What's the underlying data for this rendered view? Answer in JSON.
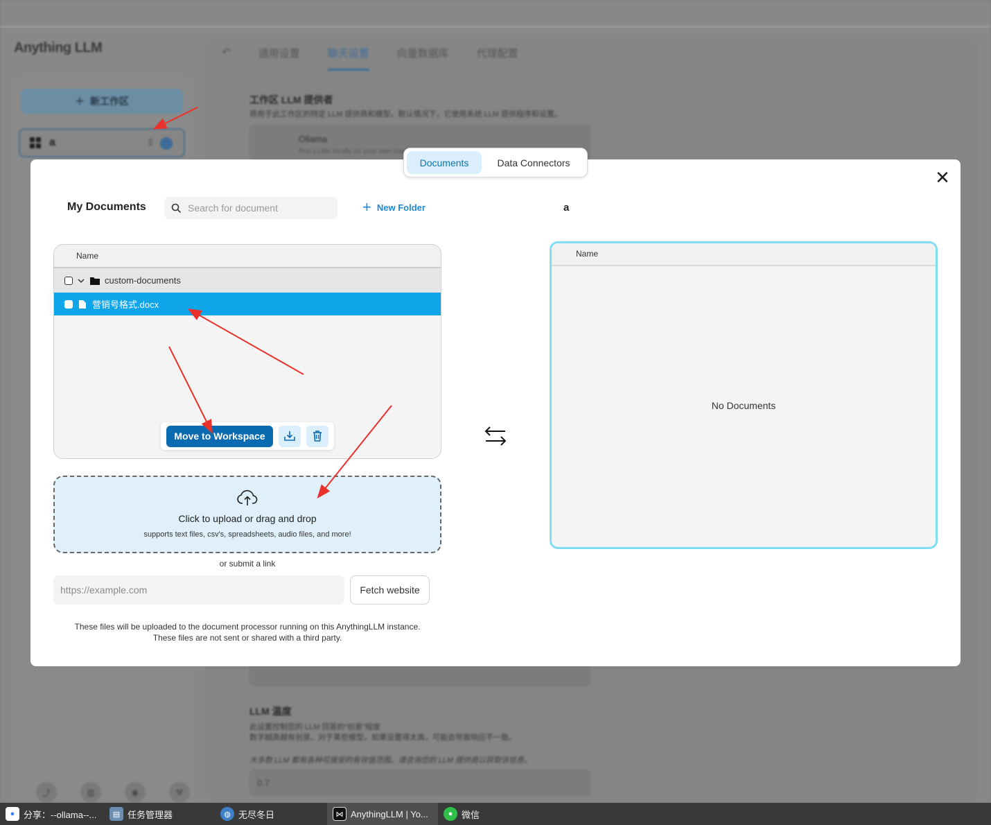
{
  "background_app": {
    "logo": "Anything LLM",
    "new_workspace_label": "新工作区",
    "workspace_name": "a",
    "tabs": [
      "通用设置",
      "聊天设置",
      "向量数据库",
      "代理配置"
    ],
    "active_tab": "聊天设置",
    "llm_provider_heading": "工作区 LLM 提供者",
    "llm_provider_desc": "将用于此工作区的特定 LLM 提供商和模型。默认情况下，它使用系统 LLM 提供程序和设置。",
    "provider_name": "Ollama",
    "provider_desc": "Run LLMs locally on your own machine.",
    "temperature_heading": "LLM 温度",
    "temperature_desc1": "此设置控制您的 LLM 回答的“创意”程度",
    "temperature_desc2": "数字越高越有创意。对于某些模型，如果设置得太高，可能会导致响应不一致。",
    "temperature_desc3": "大多数 LLM 都有各种可接受的有效值范围。请咨询您的 LLM 提供商以获取该信息。",
    "temperature_value": "0.7"
  },
  "modal": {
    "segment_tabs": [
      "Documents",
      "Data Connectors"
    ],
    "active_segment": "Documents",
    "my_documents_title": "My Documents",
    "search_placeholder": "Search for document",
    "new_folder_label": "New Folder",
    "workspace_title": "a",
    "docs_table": {
      "column_name": "Name",
      "folder": "custom-documents",
      "file": "营销号格式.docx"
    },
    "move_button": "Move to Workspace",
    "workspace_table": {
      "column_name": "Name",
      "empty_text": "No Documents"
    },
    "upload": {
      "title": "Click to upload or drag and drop",
      "subtitle": "supports text files, csv's, spreadsheets, audio files, and more!"
    },
    "or_submit_link": "or submit a link",
    "url_placeholder": "https://example.com",
    "fetch_button": "Fetch website",
    "note_line1": "These files will be uploaded to the document processor running on this AnythingLLM instance.",
    "note_line2": "These files are not sent or shared with a third party."
  },
  "taskbar": {
    "items": [
      "分享：--ollama--...",
      "任务管理器",
      "无尽冬日",
      "AnythingLLM | Yo...",
      "微信"
    ]
  },
  "colors": {
    "accent": "#0a6bb0",
    "selected_row": "#0ea5e9",
    "workspace_border": "#7fdef0",
    "annotation_arrow": "#e8322b"
  }
}
